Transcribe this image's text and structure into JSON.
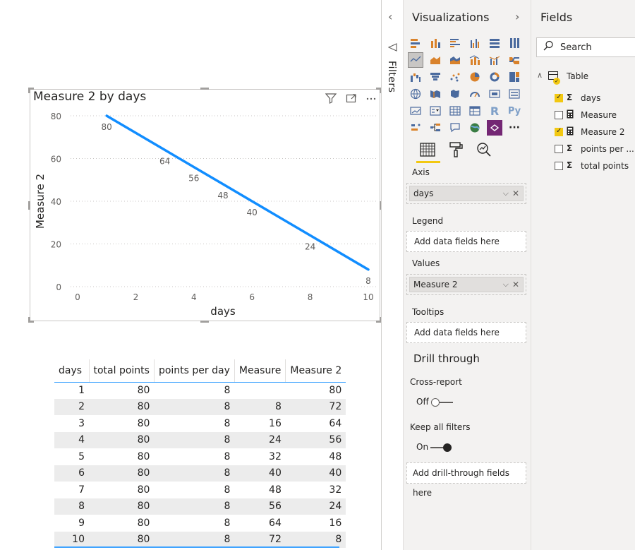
{
  "chart": {
    "title": "Measure 2 by days",
    "icons": [
      "filter-icon",
      "focus-mode-icon",
      "more-options-icon"
    ]
  },
  "chart_data": {
    "type": "line",
    "title": "Measure 2 by days",
    "xlabel": "days",
    "ylabel": "Measure 2",
    "x": [
      1,
      3,
      4,
      5,
      6,
      8,
      10
    ],
    "values": [
      80,
      64,
      56,
      48,
      40,
      24,
      8
    ],
    "xlim": [
      0,
      10
    ],
    "ylim": [
      0,
      80
    ],
    "xticks": [
      0,
      2,
      4,
      6,
      8,
      10
    ],
    "yticks": [
      0,
      20,
      40,
      60,
      80
    ],
    "grid": true,
    "color": "#118dff",
    "series": [
      {
        "values": [
          80,
          64,
          56,
          48,
          40,
          24,
          8
        ]
      }
    ]
  },
  "table": {
    "columns": [
      "days",
      "total points",
      "points per day",
      "Measure",
      "Measure 2"
    ],
    "rows": [
      [
        "1",
        "80",
        "8",
        "",
        "80"
      ],
      [
        "2",
        "80",
        "8",
        "8",
        "72"
      ],
      [
        "3",
        "80",
        "8",
        "16",
        "64"
      ],
      [
        "4",
        "80",
        "8",
        "24",
        "56"
      ],
      [
        "5",
        "80",
        "8",
        "32",
        "48"
      ],
      [
        "6",
        "80",
        "8",
        "40",
        "40"
      ],
      [
        "7",
        "80",
        "8",
        "48",
        "32"
      ],
      [
        "8",
        "80",
        "8",
        "56",
        "24"
      ],
      [
        "9",
        "80",
        "8",
        "64",
        "16"
      ],
      [
        "10",
        "80",
        "8",
        "72",
        "8"
      ]
    ]
  },
  "filters": {
    "label": "Filters",
    "collapse_icon": "‹",
    "funnel_icon": "⊲"
  },
  "viz_pane": {
    "title": "Visualizations",
    "expand_icon": "›",
    "axis_label": "Axis",
    "axis_field": "days",
    "legend_label": "Legend",
    "legend_placeholder": "Add data fields here",
    "values_label": "Values",
    "values_field": "Measure 2",
    "tooltips_label": "Tooltips",
    "tooltips_placeholder": "Add data fields here",
    "drill_heading": "Drill through",
    "cross_report_label": "Cross-report",
    "cross_report_state": "Off",
    "keep_filters_label": "Keep all filters",
    "keep_filters_state": "On",
    "drill_placeholder": "Add drill-through fields here",
    "r_glyph": "R",
    "py_glyph": "Py",
    "more_glyph": "···",
    "accent": "#f2c811"
  },
  "fields_pane": {
    "title": "Fields",
    "search_placeholder": "Search",
    "table_name": "Table",
    "fields": [
      {
        "label": "days",
        "type": "sigma",
        "checked": true
      },
      {
        "label": "Measure",
        "type": "calculator",
        "checked": false
      },
      {
        "label": "Measure 2",
        "type": "calculator",
        "checked": true
      },
      {
        "label": "points per ...",
        "type": "sigma",
        "checked": false
      },
      {
        "label": "total points",
        "type": "sigma",
        "checked": false
      }
    ]
  }
}
